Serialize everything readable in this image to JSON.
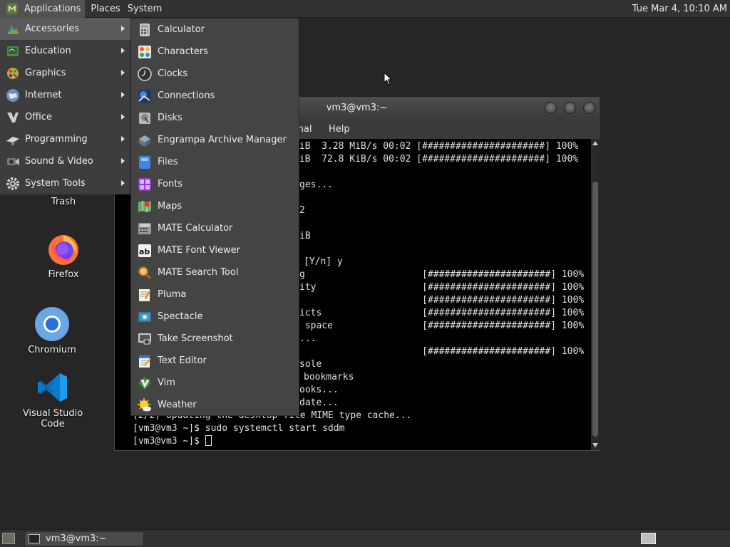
{
  "top_panel": {
    "menus": [
      "Applications",
      "Places",
      "System"
    ],
    "clock": "Tue Mar  4, 10:10 AM"
  },
  "desktop": {
    "icons": [
      {
        "label": "Trash",
        "icon": "trash-icon"
      },
      {
        "label": "Firefox",
        "icon": "firefox-icon"
      },
      {
        "label": "Chromium",
        "icon": "chromium-icon"
      },
      {
        "label": "Visual Studio Code",
        "icon": "vscode-icon"
      }
    ]
  },
  "app_menu": {
    "categories": [
      {
        "label": "Accessories",
        "icon": "accessories-icon",
        "active": true
      },
      {
        "label": "Education",
        "icon": "education-icon"
      },
      {
        "label": "Graphics",
        "icon": "graphics-icon"
      },
      {
        "label": "Internet",
        "icon": "internet-icon"
      },
      {
        "label": "Office",
        "icon": "office-icon"
      },
      {
        "label": "Programming",
        "icon": "programming-icon"
      },
      {
        "label": "Sound & Video",
        "icon": "sound-video-icon"
      },
      {
        "label": "System Tools",
        "icon": "system-tools-icon"
      }
    ],
    "accessories": [
      {
        "label": "Calculator",
        "icon": "calculator-icon"
      },
      {
        "label": "Characters",
        "icon": "characters-icon"
      },
      {
        "label": "Clocks",
        "icon": "clock-icon"
      },
      {
        "label": "Connections",
        "icon": "connections-icon"
      },
      {
        "label": "Disks",
        "icon": "disks-icon"
      },
      {
        "label": "Engrampa Archive Manager",
        "icon": "archive-icon"
      },
      {
        "label": "Files",
        "icon": "files-icon"
      },
      {
        "label": "Fonts",
        "icon": "fonts-icon"
      },
      {
        "label": "Maps",
        "icon": "maps-icon"
      },
      {
        "label": "MATE Calculator",
        "icon": "mate-calculator-icon"
      },
      {
        "label": "MATE Font Viewer",
        "icon": "font-viewer-icon"
      },
      {
        "label": "MATE Search Tool",
        "icon": "search-tool-icon"
      },
      {
        "label": "Pluma",
        "icon": "pluma-icon"
      },
      {
        "label": "Spectacle",
        "icon": "spectacle-icon"
      },
      {
        "label": "Take Screenshot",
        "icon": "screenshot-icon"
      },
      {
        "label": "Text Editor",
        "icon": "text-editor-icon"
      },
      {
        "label": "Vim",
        "icon": "vim-icon"
      },
      {
        "label": "Weather",
        "icon": "weather-icon"
      }
    ]
  },
  "terminal": {
    "title": "vm3@vm3:~",
    "menus": [
      "inal",
      "Help"
    ],
    "lines": [
      "MiB  3.28 MiB/s 00:02 [######################] 100%",
      "KiB  72.8 KiB/s 00:02 [######################] 100%",
      "",
      "ges...",
      "",
      "2",
      "",
      "iB",
      "",
      "[Y/n] y",
      "g                     [######################] 100%",
      "ity                   [######################] 100%",
      "                      [######################] 100%",
      "icts                  [######################] 100%",
      " space                [######################] 100%",
      "...",
      "                      [######################] 100%",
      "sole",
      "bookmarks",
      "ooks...",
      "date...",
      "(2/2) Updating the desktop file MIME type cache...",
      "[vm3@vm3 ~]$ sudo systemctl start sddm",
      "[vm3@vm3 ~]$ "
    ]
  },
  "taskbar": {
    "tasks": [
      {
        "label": "vm3@vm3:~"
      }
    ]
  },
  "colors": {
    "desktop_bg": "#262626",
    "panel_bg": "#323232",
    "menu_bg": "#444444",
    "menu_active": "#5a5a5a"
  }
}
